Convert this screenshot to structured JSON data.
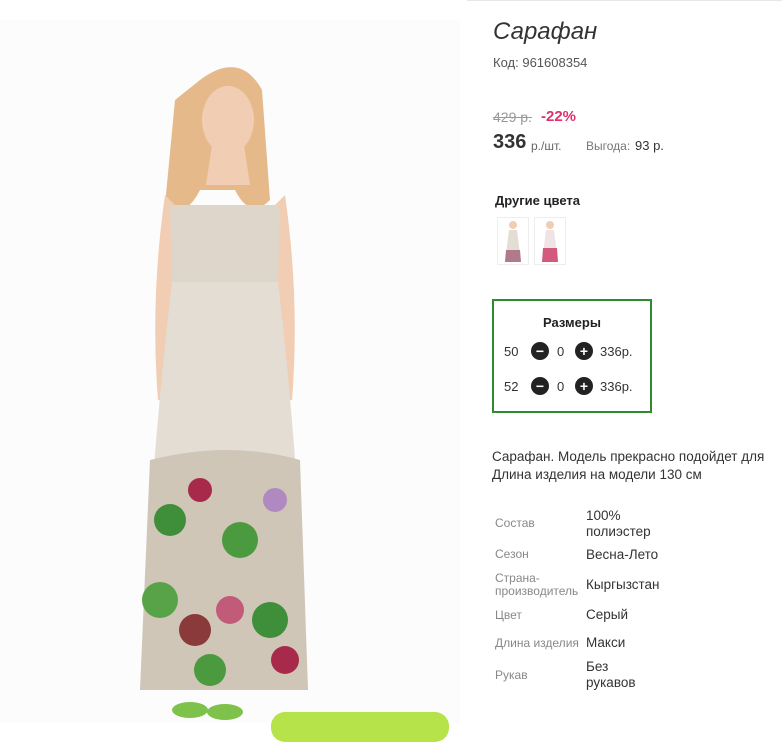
{
  "product": {
    "title": "Сарафан",
    "code_label": "Код:",
    "code_value": "961608354",
    "old_price": "429 р.",
    "discount": "-22%",
    "price": "336",
    "price_unit": "р./шт.",
    "benefit_label": "Выгода:",
    "benefit_value": "93 р."
  },
  "colors": {
    "title": "Другие цвета",
    "swatches": [
      "dress-swatch-1",
      "dress-swatch-2"
    ]
  },
  "sizes": {
    "title": "Размеры",
    "rows": [
      {
        "size": "50",
        "qty": "0",
        "price": "336р."
      },
      {
        "size": "52",
        "qty": "0",
        "price": "336р."
      }
    ],
    "minus_glyph": "−",
    "plus_glyph": "+"
  },
  "description": {
    "line1": "Сарафан. Модель прекрасно подойдет для",
    "line2": "Длина изделия на модели 130 см"
  },
  "attributes": [
    {
      "label": "Состав",
      "value": "100% полиэстер"
    },
    {
      "label": "Сезон",
      "value": "Весна-Лето"
    },
    {
      "label": "Страна-производитель",
      "value": "Кыргызстан"
    },
    {
      "label": "Цвет",
      "value": "Серый"
    },
    {
      "label": "Длина изделия",
      "value": "Макси"
    },
    {
      "label": "Рукав",
      "value": "Без рукавов"
    }
  ],
  "colors_palette": {
    "accent_discount": "#e0306b",
    "sizes_border": "#2e8b2e",
    "cta_green": "#b7e34a"
  }
}
